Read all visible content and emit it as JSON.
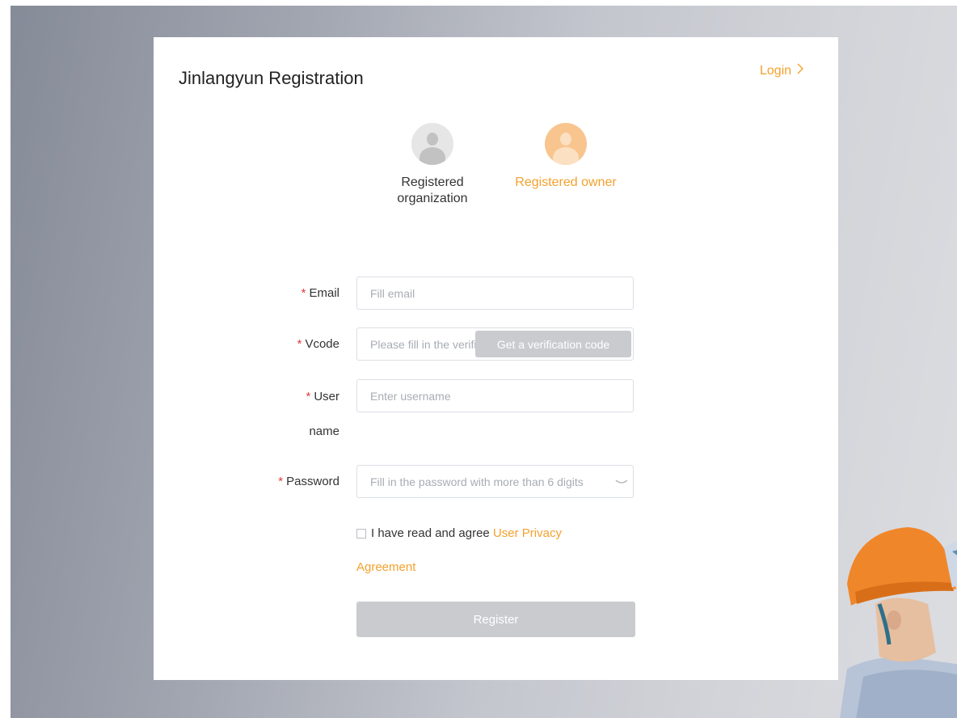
{
  "page": {
    "title": "Jinlangyun Registration",
    "login_link": "Login"
  },
  "roles": [
    {
      "label": "Registered organization",
      "line1": "Registered",
      "line2": "organization",
      "selected": false
    },
    {
      "label": "Registered owner",
      "selected": true
    }
  ],
  "form": {
    "email": {
      "label": "Email",
      "placeholder": "Fill email",
      "value": ""
    },
    "vcode": {
      "label": "Vcode",
      "placeholder": "Please fill in the verification code",
      "button": "Get a verification code",
      "value": ""
    },
    "username": {
      "label_line1": "User",
      "label_line2": "name",
      "placeholder": "Enter username",
      "value": ""
    },
    "password": {
      "label": "Password",
      "placeholder": "Fill in the password with more than 6 digits",
      "value": ""
    },
    "required_marker": "*",
    "agreement": {
      "text": "I have read and agree",
      "link_line1": "User Privacy",
      "link_line2": "Agreement",
      "checked": false
    },
    "submit": "Register"
  },
  "colors": {
    "accent": "#f3a12d",
    "required": "#e23b3b",
    "disabled_button": "#c9cbcf"
  },
  "icons": {
    "login_chevron": "chevron-right-icon",
    "password_toggle": "eye-closed-icon"
  }
}
